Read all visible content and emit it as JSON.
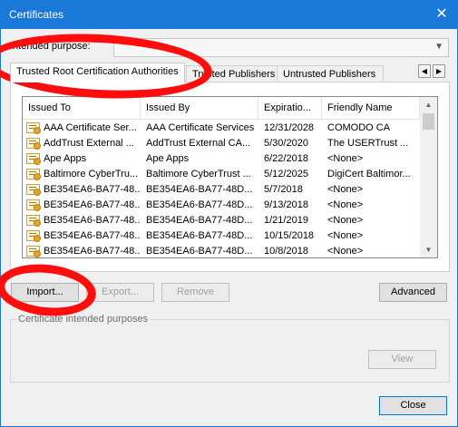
{
  "window": {
    "title": "Certificates"
  },
  "purpose": {
    "label": "Intended purpose:",
    "value": ""
  },
  "tabs": [
    {
      "label": "Trusted Root Certification Authorities"
    },
    {
      "label": "Trusted Publishers"
    },
    {
      "label": "Untrusted Publishers"
    }
  ],
  "table": {
    "columns": [
      "Issued To",
      "Issued By",
      "Expiratio...",
      "Friendly Name"
    ],
    "rows": [
      [
        "AAA Certificate Ser...",
        "AAA Certificate Services",
        "12/31/2028",
        "COMODO CA"
      ],
      [
        "AddTrust External ...",
        "AddTrust External CA...",
        "5/30/2020",
        "The USERTrust ..."
      ],
      [
        "Ape Apps",
        "Ape Apps",
        "6/22/2018",
        "<None>"
      ],
      [
        "Baltimore CyberTru...",
        "Baltimore CyberTrust ...",
        "5/12/2025",
        "DigiCert Baltimor..."
      ],
      [
        "BE354EA6-BA77-48...",
        "BE354EA6-BA77-48D...",
        "5/7/2018",
        "<None>"
      ],
      [
        "BE354EA6-BA77-48...",
        "BE354EA6-BA77-48D...",
        "9/13/2018",
        "<None>"
      ],
      [
        "BE354EA6-BA77-48...",
        "BE354EA6-BA77-48D...",
        "1/21/2019",
        "<None>"
      ],
      [
        "BE354EA6-BA77-48...",
        "BE354EA6-BA77-48D...",
        "10/15/2018",
        "<None>"
      ],
      [
        "BE354EA6-BA77-48...",
        "BE354EA6-BA77-48D...",
        "10/8/2018",
        "<None>"
      ]
    ]
  },
  "buttons": {
    "import": "Import...",
    "export": "Export...",
    "remove": "Remove",
    "advanced": "Advanced",
    "view": "View",
    "close": "Close"
  },
  "group": {
    "title": "Certificate intended purposes"
  },
  "colors": {
    "titlebar": "#1a78d8",
    "annotation": "#ff0c0c"
  }
}
